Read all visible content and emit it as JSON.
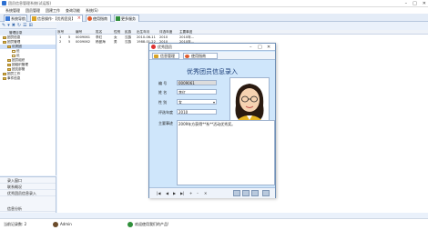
{
  "window": {
    "title": "团员信息管理系统(试运版)",
    "min": "–",
    "max": "□",
    "close": "✕"
  },
  "menu": [
    "系统管理",
    "团员管理",
    "团建工作",
    "查询功能",
    "系统(S)"
  ],
  "tabs": [
    {
      "label": "系统导航",
      "active": false
    },
    {
      "label": "信息操作-【优秀团员】",
      "active": true
    },
    {
      "label": "使用指南",
      "active": false
    },
    {
      "label": "更多服务",
      "active": false
    }
  ],
  "toolbar": {
    "icons": [
      "✎",
      "▾",
      "✖",
      "↻",
      "☰",
      "⊞"
    ]
  },
  "tree": {
    "header": "管理目录",
    "nodes": [
      {
        "label": "团员信息",
        "level": 0
      },
      {
        "label": "团员管理",
        "level": 0
      },
      {
        "label": "优秀团",
        "level": 1
      },
      {
        "label": "优",
        "level": 2
      },
      {
        "label": "优",
        "level": 2
      },
      {
        "label": "团员组织",
        "level": 1
      },
      {
        "label": "团组织管理",
        "level": 1
      },
      {
        "label": "团支部管",
        "level": 1
      },
      {
        "label": "团员工作",
        "level": 0
      },
      {
        "label": "事件信息",
        "level": 0
      }
    ]
  },
  "leftnav": [
    "录入窗口",
    "联系概况",
    "优秀团员信息录入",
    "信息分析"
  ],
  "grid": {
    "headers": [
      "序号",
      "编号",
      "姓名",
      "性别",
      "民族",
      "出生年月",
      "评选年度",
      "主要事迹"
    ],
    "rows": [
      [
        "1",
        "5",
        "0009061",
        "李红",
        "女",
        "汉族",
        "2010-06-11",
        "2010",
        "2010年..."
      ],
      [
        "2",
        "5",
        "0009062",
        "杨曼海",
        "男",
        "汉族",
        "1988-01-22",
        "2010",
        "2010年..."
      ]
    ]
  },
  "status": {
    "left": "当前记录数: 2",
    "user": "Admin",
    "center": "欢迎使用我们的产品!"
  },
  "dialog": {
    "title": "优秀团员",
    "tab_info": "信息管理",
    "tab_guide": "使用指南",
    "form_title": "优秀团员信息录入",
    "labels": {
      "code": "编    号",
      "name": "姓    名",
      "gender": "性    别",
      "year": "评选年度",
      "remarks": "主要事迹"
    },
    "values": {
      "code": "0009061",
      "name": "李红",
      "gender": "女",
      "year": "2010",
      "remarks": "2009年方获得**系**活动优秀奖。"
    },
    "nav": [
      "|◀",
      "◀",
      "▶",
      "▶|",
      "+",
      "–",
      "✕"
    ]
  },
  "colors": {
    "accent": "#2c6fd1",
    "dialog_bg": "#cfe6fb",
    "title_text": "#1c3e78"
  }
}
